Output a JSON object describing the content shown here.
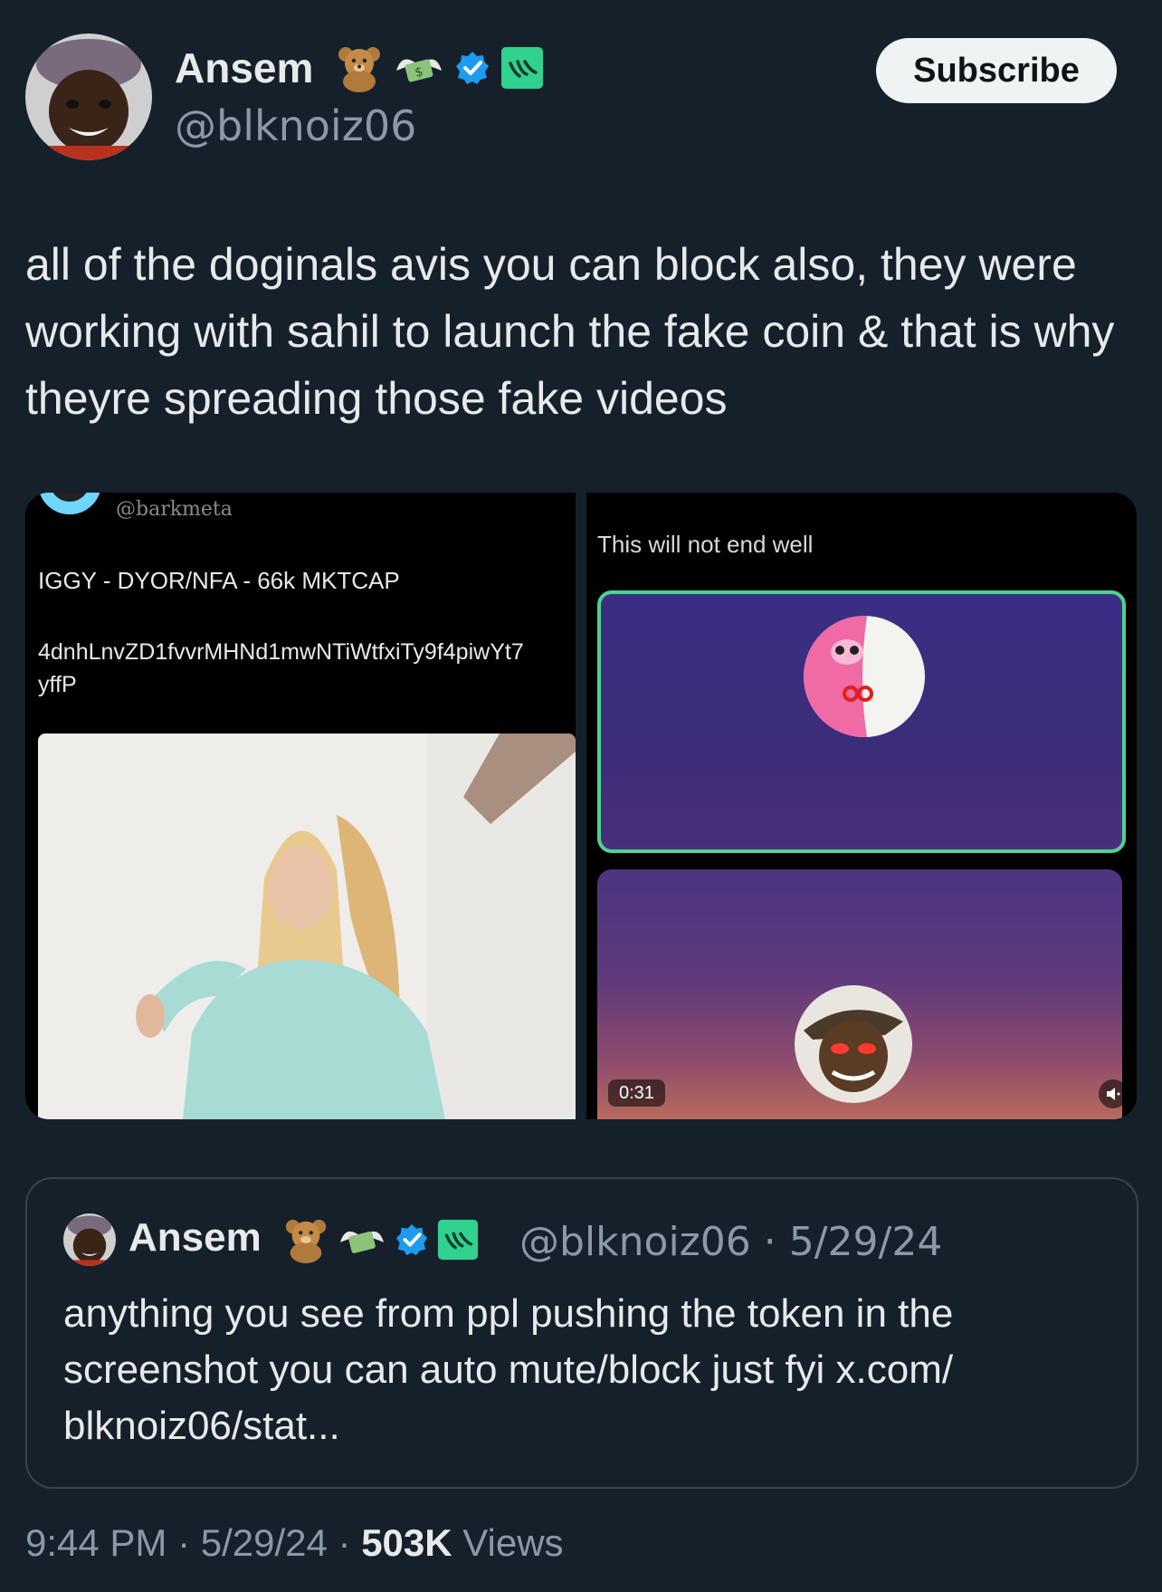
{
  "author": {
    "name": "Ansem",
    "handle": "@blknoiz06",
    "badge_emojis": [
      "teddy-bear",
      "money-with-wings"
    ],
    "verified": true
  },
  "subscribe_label": "Subscribe",
  "tweet_text": "all of the doginals avis you can block also, they were working with sahil to launch the fake coin & that is why theyre spreading those fake videos",
  "media": {
    "left": {
      "handle": "@barkmeta",
      "title": "IGGY - DYOR/NFA - 66k MKTCAP",
      "address_line1": "4dnhLnvZD1fvvrMHNd1mwNTiWtfxiTy9f4piwYt7",
      "address_line2": "yffP"
    },
    "right": {
      "caption": "This will not end well",
      "duration": "0:31"
    }
  },
  "quote": {
    "name": "Ansem",
    "handle_date": "@blknoiz06 · 5/29/24",
    "text": "anything you see from ppl pushing the token in the screenshot you can auto mute/block just fyi x.com/ blknoiz06/stat..."
  },
  "footer": {
    "time_date": "9:44 PM · 5/29/24 · ",
    "views_count": "503K",
    "views_label": " Views"
  },
  "colors": {
    "background": "#15202b",
    "verified_blue": "#1d9bf0",
    "green_badge": "#31d18f",
    "secondary_text": "#8b98a5"
  }
}
